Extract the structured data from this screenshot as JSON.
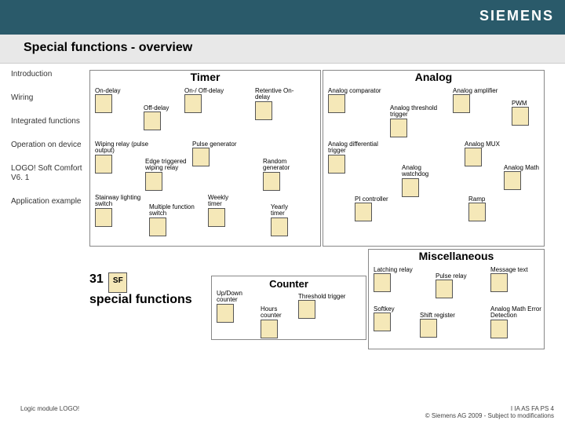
{
  "brand": "SIEMENS",
  "page_title": "Special functions - overview",
  "sidebar": {
    "items": [
      {
        "label": "Introduction"
      },
      {
        "label": "Wiring"
      },
      {
        "label": "Integrated functions"
      },
      {
        "label": "Operation on device"
      },
      {
        "label": "LOGO! Soft Comfort V6. 1"
      },
      {
        "label": "Application example"
      }
    ]
  },
  "sections": {
    "timer": {
      "title": "Timer",
      "functions": [
        {
          "label": "On-delay"
        },
        {
          "label": "On-/ Off-delay"
        },
        {
          "label": "Retentive On-delay"
        },
        {
          "label": "Off-delay"
        },
        {
          "label": "Wiping relay (pulse output)"
        },
        {
          "label": "Pulse generator"
        },
        {
          "label": "Edge triggered wiping relay"
        },
        {
          "label": "Random generator"
        },
        {
          "label": "Stairway lighting switch"
        },
        {
          "label": "Weekly timer"
        },
        {
          "label": "Multiple function switch"
        },
        {
          "label": "Yearly timer"
        }
      ]
    },
    "analog": {
      "title": "Analog",
      "functions": [
        {
          "label": "Analog comparator"
        },
        {
          "label": "Analog amplifier"
        },
        {
          "label": "Analog threshold trigger"
        },
        {
          "label": "PWM"
        },
        {
          "label": "Analog differential trigger"
        },
        {
          "label": "Analog MUX"
        },
        {
          "label": "Analog watchdog"
        },
        {
          "label": "Analog Math"
        },
        {
          "label": "PI controller"
        },
        {
          "label": "Ramp"
        }
      ]
    },
    "counter": {
      "title": "Counter",
      "functions": [
        {
          "label": "Up/Down counter"
        },
        {
          "label": "Threshold trigger"
        },
        {
          "label": "Hours counter"
        }
      ]
    },
    "misc": {
      "title": "Miscellaneous",
      "functions": [
        {
          "label": "Latching relay"
        },
        {
          "label": "Message text"
        },
        {
          "label": "Pulse relay"
        },
        {
          "label": "Softkey"
        },
        {
          "label": "Analog Math Error Detection"
        },
        {
          "label": "Shift register"
        }
      ]
    }
  },
  "special_count": {
    "number": "31",
    "text": "special functions",
    "sf": "SF"
  },
  "footer": {
    "left": "Logic module LOGO!",
    "right_line1": "I IA AS FA PS 4",
    "right_line2": "© Siemens AG 2009 - Subject to modifications"
  }
}
